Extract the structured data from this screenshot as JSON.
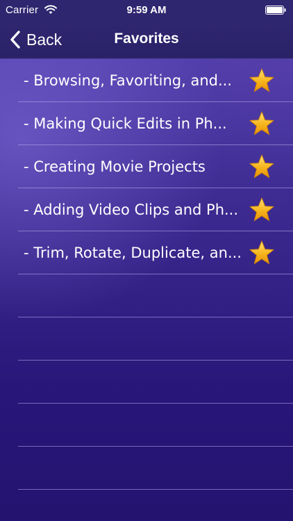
{
  "status": {
    "carrier": "Carrier",
    "time": "9:59 AM"
  },
  "nav": {
    "back_label": "Back",
    "title": "Favorites"
  },
  "items": [
    {
      "label": "- Browsing, Favoriting, and..."
    },
    {
      "label": "- Making Quick Edits in Ph..."
    },
    {
      "label": "- Creating Movie Projects"
    },
    {
      "label": "- Adding Video Clips and Ph..."
    },
    {
      "label": "- Trim, Rotate, Duplicate, an..."
    }
  ],
  "colors": {
    "bar": "#2f2670",
    "background_top": "#5a47b5",
    "background_bottom": "#24146f",
    "star": "#f7b51c",
    "separator": "#beaff0"
  },
  "icons": {
    "back": "chevron-left-icon",
    "favorite": "star-icon",
    "wifi": "wifi-icon",
    "battery": "battery-icon"
  }
}
